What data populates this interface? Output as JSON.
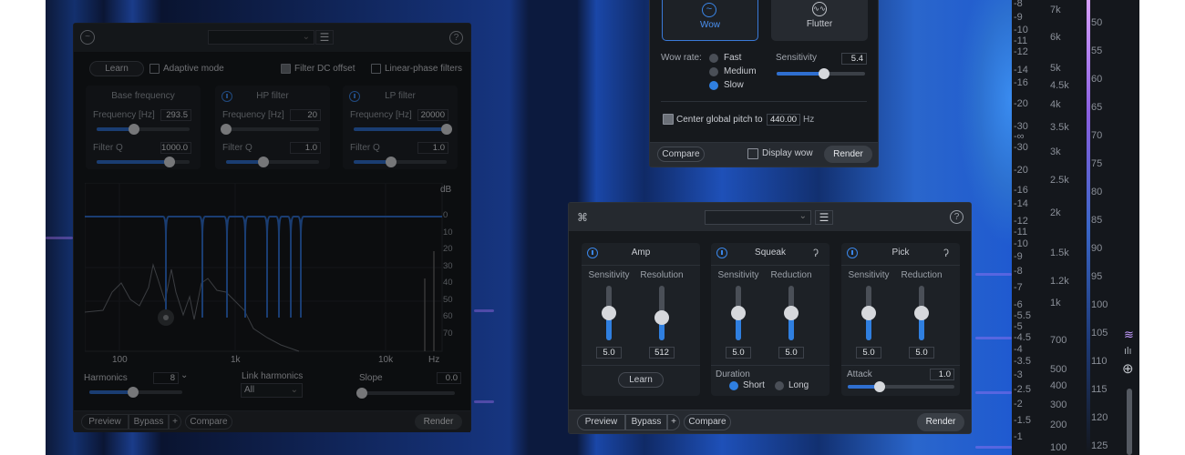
{
  "rulers": {
    "amplitude_db": [
      "-8",
      "-9",
      "-10",
      "-11",
      "-12",
      "-14",
      "-16",
      "-20",
      "-30",
      "-∞",
      "-30",
      "-20",
      "-16",
      "-14",
      "-12",
      "-11",
      "-10",
      "-9",
      "-8",
      "-7",
      "-6",
      "-5.5",
      "-5",
      "-4.5",
      "-4",
      "-3.5",
      "-3",
      "-2.5",
      "-2",
      "-1.5",
      "-1"
    ],
    "frequency": [
      "7k",
      "6k",
      "5k",
      "4.5k",
      "4k",
      "3.5k",
      "3k",
      "2.5k",
      "2k",
      "1.5k",
      "1.2k",
      "1k",
      "700",
      "500",
      "400",
      "300",
      "200",
      "100"
    ],
    "color_scale": [
      "50",
      "55",
      "60",
      "65",
      "70",
      "75",
      "80",
      "85",
      "90",
      "95",
      "100",
      "105",
      "110",
      "115",
      "120",
      "125"
    ],
    "icons": [
      "waveform-spectrogram-icon",
      "waveform-icon",
      "zoom-in-icon"
    ]
  },
  "hum_panel": {
    "icon": "hum-icon",
    "learn": "Learn",
    "adaptive_mode": "Adaptive mode",
    "filter_dc": "Filter DC offset",
    "linear_phase": "Linear-phase filters",
    "filter_dc_checked": true,
    "adaptive_checked": false,
    "linear_checked": false,
    "base": {
      "title": "Base frequency",
      "freq_label": "Frequency [Hz]",
      "freq": "293.5",
      "freq_level": 0.4,
      "q_label": "Filter Q",
      "q": "1000.0",
      "q_level": 0.78
    },
    "hp": {
      "title": "HP filter",
      "freq_label": "Frequency [Hz]",
      "freq": "20",
      "freq_level": 0,
      "q_label": "Filter Q",
      "q": "1.0",
      "q_level": 0.4
    },
    "lp": {
      "title": "LP filter",
      "freq_label": "Frequency [Hz]",
      "freq": "20000",
      "freq_level": 1,
      "q_label": "Filter Q",
      "q": "1.0",
      "q_level": 0.4
    },
    "graph": {
      "db_unit": "dB",
      "db_ticks": [
        "0",
        "10",
        "20",
        "30",
        "40",
        "50",
        "60",
        "70"
      ],
      "hz_ticks": [
        "100",
        "1k",
        "10k"
      ],
      "hz_unit": "Hz",
      "curve_color": "#2f6fd0"
    },
    "harmonics_label": "Harmonics",
    "harmonics": "8",
    "harmonics_level": 0.47,
    "link_label": "Link harmonics",
    "link": "All",
    "slope_label": "Slope",
    "slope": "0.0",
    "slope_level": 0,
    "footer": {
      "preview": "Preview",
      "bypass": "Bypass",
      "plus": "+",
      "compare": "Compare",
      "render": "Render"
    }
  },
  "wow_panel": {
    "modes": [
      {
        "label": "Wow",
        "icon": "wow-icon",
        "selected": true
      },
      {
        "label": "Flutter",
        "icon": "flutter-icon",
        "selected": false
      }
    ],
    "rate_label": "Wow rate:",
    "rates": [
      {
        "label": "Fast",
        "selected": false
      },
      {
        "label": "Medium",
        "selected": false
      },
      {
        "label": "Slow",
        "selected": true
      }
    ],
    "sensitivity_label": "Sensitivity",
    "sensitivity": "5.4",
    "sensitivity_level": 0.54,
    "center_label": "Center global pitch to",
    "center_value": "440.00",
    "center_unit": "Hz",
    "center_checked": true,
    "compare": "Compare",
    "display_wow": "Display wow",
    "render": "Render"
  },
  "guitar_panel": {
    "icon": "guitar-icon",
    "amp": {
      "title": "Amp",
      "s1": "Sensitivity",
      "s2": "Resolution",
      "v1": "5.0",
      "v2": "512",
      "l1": 0.5,
      "l2": 0.42,
      "learn": "Learn"
    },
    "squeak": {
      "title": "Squeak",
      "s1": "Sensitivity",
      "s2": "Reduction",
      "v1": "5.0",
      "v2": "5.0",
      "l1": 0.5,
      "l2": 0.5,
      "duration": "Duration",
      "short": "Short",
      "long": "Long"
    },
    "pick": {
      "title": "Pick",
      "s1": "Sensitivity",
      "s2": "Reduction",
      "v1": "5.0",
      "v2": "5.0",
      "l1": 0.5,
      "l2": 0.5,
      "attack": "Attack",
      "attack_value": "1.0",
      "attack_level": 0.3
    },
    "footer": {
      "preview": "Preview",
      "bypass": "Bypass",
      "plus": "+",
      "compare": "Compare",
      "render": "Render"
    }
  }
}
